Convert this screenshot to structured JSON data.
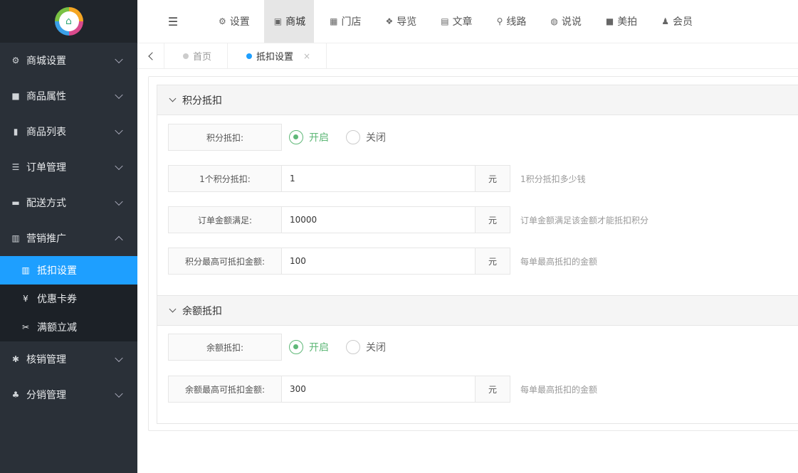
{
  "sidebar": {
    "menu": [
      {
        "label": "商城设置",
        "icon": "gears-icon"
      },
      {
        "label": "商品属性",
        "icon": "cube-icon"
      },
      {
        "label": "商品列表",
        "icon": "cart-icon"
      },
      {
        "label": "订单管理",
        "icon": "list-icon"
      },
      {
        "label": "配送方式",
        "icon": "car-icon"
      },
      {
        "label": "营销推广",
        "icon": "bar-chart-icon"
      }
    ],
    "submenu": [
      {
        "label": "抵扣设置",
        "icon": "bar-chart-icon"
      },
      {
        "label": "优惠卡券",
        "icon": "yen-icon",
        "glyph": "¥"
      },
      {
        "label": "满额立减",
        "icon": "scissors-icon",
        "glyph": "✂"
      }
    ],
    "menu_after": [
      {
        "label": "核销管理",
        "icon": "asterisk-icon"
      },
      {
        "label": "分销管理",
        "icon": "sitemap-icon"
      }
    ]
  },
  "topnav": {
    "items": [
      {
        "label": "设置",
        "icon": "gears-icon"
      },
      {
        "label": "商城",
        "icon": "shop-bag-icon"
      },
      {
        "label": "门店",
        "icon": "bank-icon"
      },
      {
        "label": "导览",
        "icon": "cubes-icon"
      },
      {
        "label": "文章",
        "icon": "newspaper-icon"
      },
      {
        "label": "线路",
        "icon": "route-icon"
      },
      {
        "label": "说说",
        "icon": "chat-icon"
      },
      {
        "label": "美拍",
        "icon": "video-icon"
      },
      {
        "label": "会员",
        "icon": "user-icon"
      }
    ],
    "active_index": 1
  },
  "tabs": [
    {
      "label": "首页"
    },
    {
      "label": "抵扣设置",
      "close": "×"
    }
  ],
  "points_section": {
    "title": "积分抵扣",
    "switch": {
      "label": "积分抵扣:",
      "on_label": "开启",
      "off_label": "关闭",
      "value": "on"
    },
    "per_point": {
      "label": "1个积分抵扣:",
      "value": "1",
      "unit": "元",
      "hint": "1积分抵扣多少钱"
    },
    "order_min": {
      "label": "订单金额满足:",
      "value": "10000",
      "unit": "元",
      "hint": "订单金额满足该金额才能抵扣积分"
    },
    "max_amount": {
      "label": "积分最高可抵扣金额:",
      "value": "100",
      "unit": "元",
      "hint": "每单最高抵扣的金额"
    }
  },
  "balance_section": {
    "title": "余额抵扣",
    "switch": {
      "label": "余额抵扣:",
      "on_label": "开启",
      "off_label": "关闭",
      "value": "on"
    },
    "max_amount": {
      "label": "余额最高可抵扣金额:",
      "value": "300",
      "unit": "元",
      "hint": "每单最高抵扣的金额"
    }
  },
  "colors": {
    "accent": "#1e9fff",
    "success": "#5fb878",
    "sidebar_bg": "#2a3038"
  }
}
